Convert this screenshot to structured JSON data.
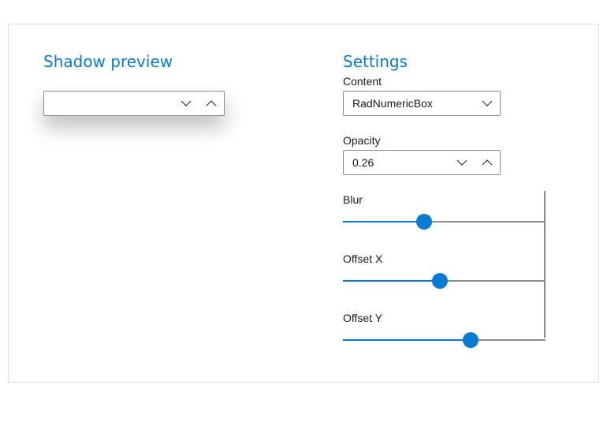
{
  "preview": {
    "title": "Shadow preview",
    "numeric_value": ""
  },
  "settings": {
    "title": "Settings",
    "content": {
      "label": "Content",
      "selected": "RadNumericBox"
    },
    "opacity": {
      "label": "Opacity",
      "value": "0.26"
    },
    "blur": {
      "label": "Blur",
      "fraction": 0.4
    },
    "offset_x": {
      "label": "Offset X",
      "fraction": 0.48
    },
    "offset_y": {
      "label": "Offset Y",
      "fraction": 0.63
    }
  },
  "colors": {
    "accent": "#0a7bd4",
    "track": "#8c8c8c"
  },
  "icons": [
    "chevron-down-icon",
    "chevron-up-icon"
  ]
}
